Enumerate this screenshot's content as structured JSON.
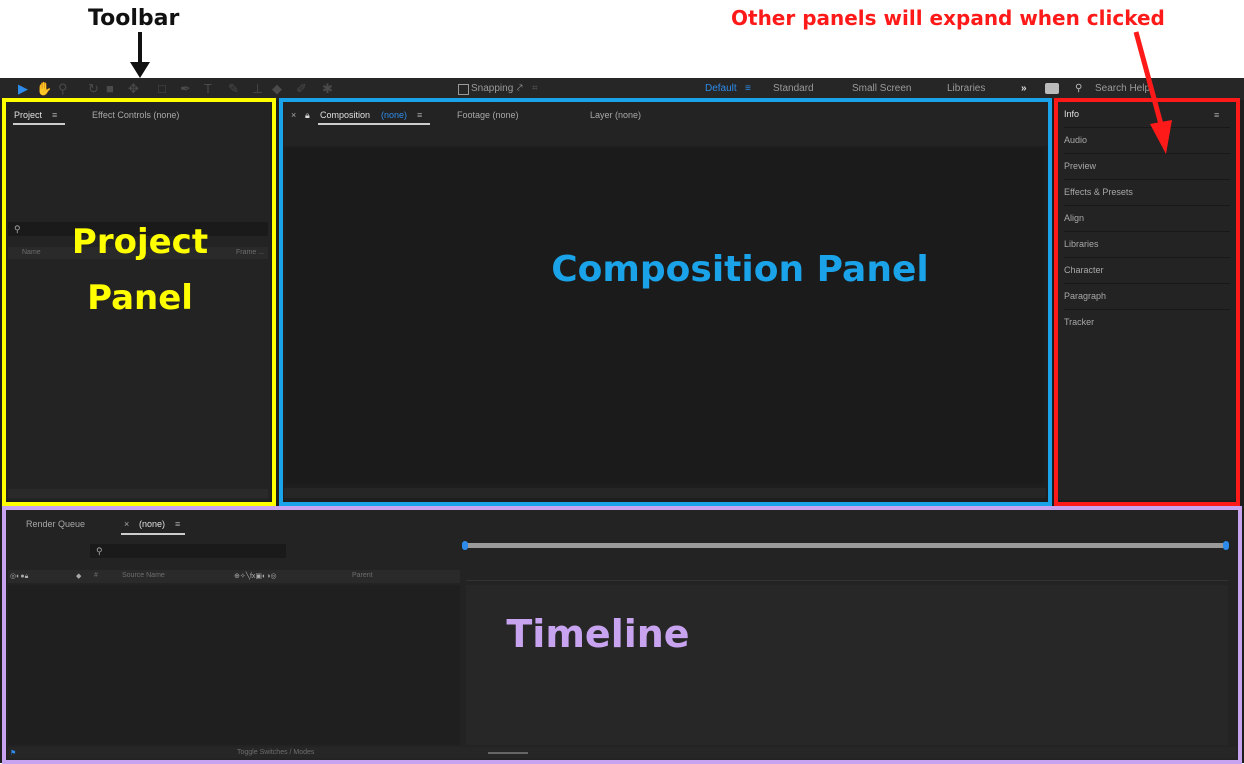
{
  "annotations": {
    "toolbar_label": "Toolbar",
    "other_panels_label": "Other panels will expand when clicked",
    "project_panel": "Project\nPanel",
    "composition_panel": "Composition Panel",
    "timeline": "Timeline"
  },
  "colors": {
    "project_outline": "#ffff00",
    "composition_outline": "#1aa3e8",
    "right_outline": "#ff1a1a",
    "timeline_outline": "#c8a4f0",
    "accent_blue": "#2d8ceb"
  },
  "toolbar": {
    "snapping_label": "Snapping",
    "workspaces": [
      "Default",
      "Standard",
      "Small Screen",
      "Libraries"
    ],
    "active_workspace": "Default",
    "search_placeholder": "Search Help"
  },
  "project_panel": {
    "tab_project": "Project",
    "tab_effect_controls": "Effect Controls (none)",
    "col_name": "Name",
    "col_frame": "Frame ..."
  },
  "composition_panel": {
    "tab_composition": "Composition",
    "tab_composition_value": "(none)",
    "tab_footage": "Footage (none)",
    "tab_layer": "Layer (none)"
  },
  "right_panels": {
    "items": [
      "Info",
      "Audio",
      "Preview",
      "Effects & Presets",
      "Align",
      "Libraries",
      "Character",
      "Paragraph",
      "Tracker"
    ]
  },
  "timeline": {
    "tab_render_queue": "Render Queue",
    "tab_comp": "(none)",
    "col_source_name": "Source Name",
    "col_parent": "Parent",
    "toggle_label": "Toggle Switches / Modes"
  }
}
